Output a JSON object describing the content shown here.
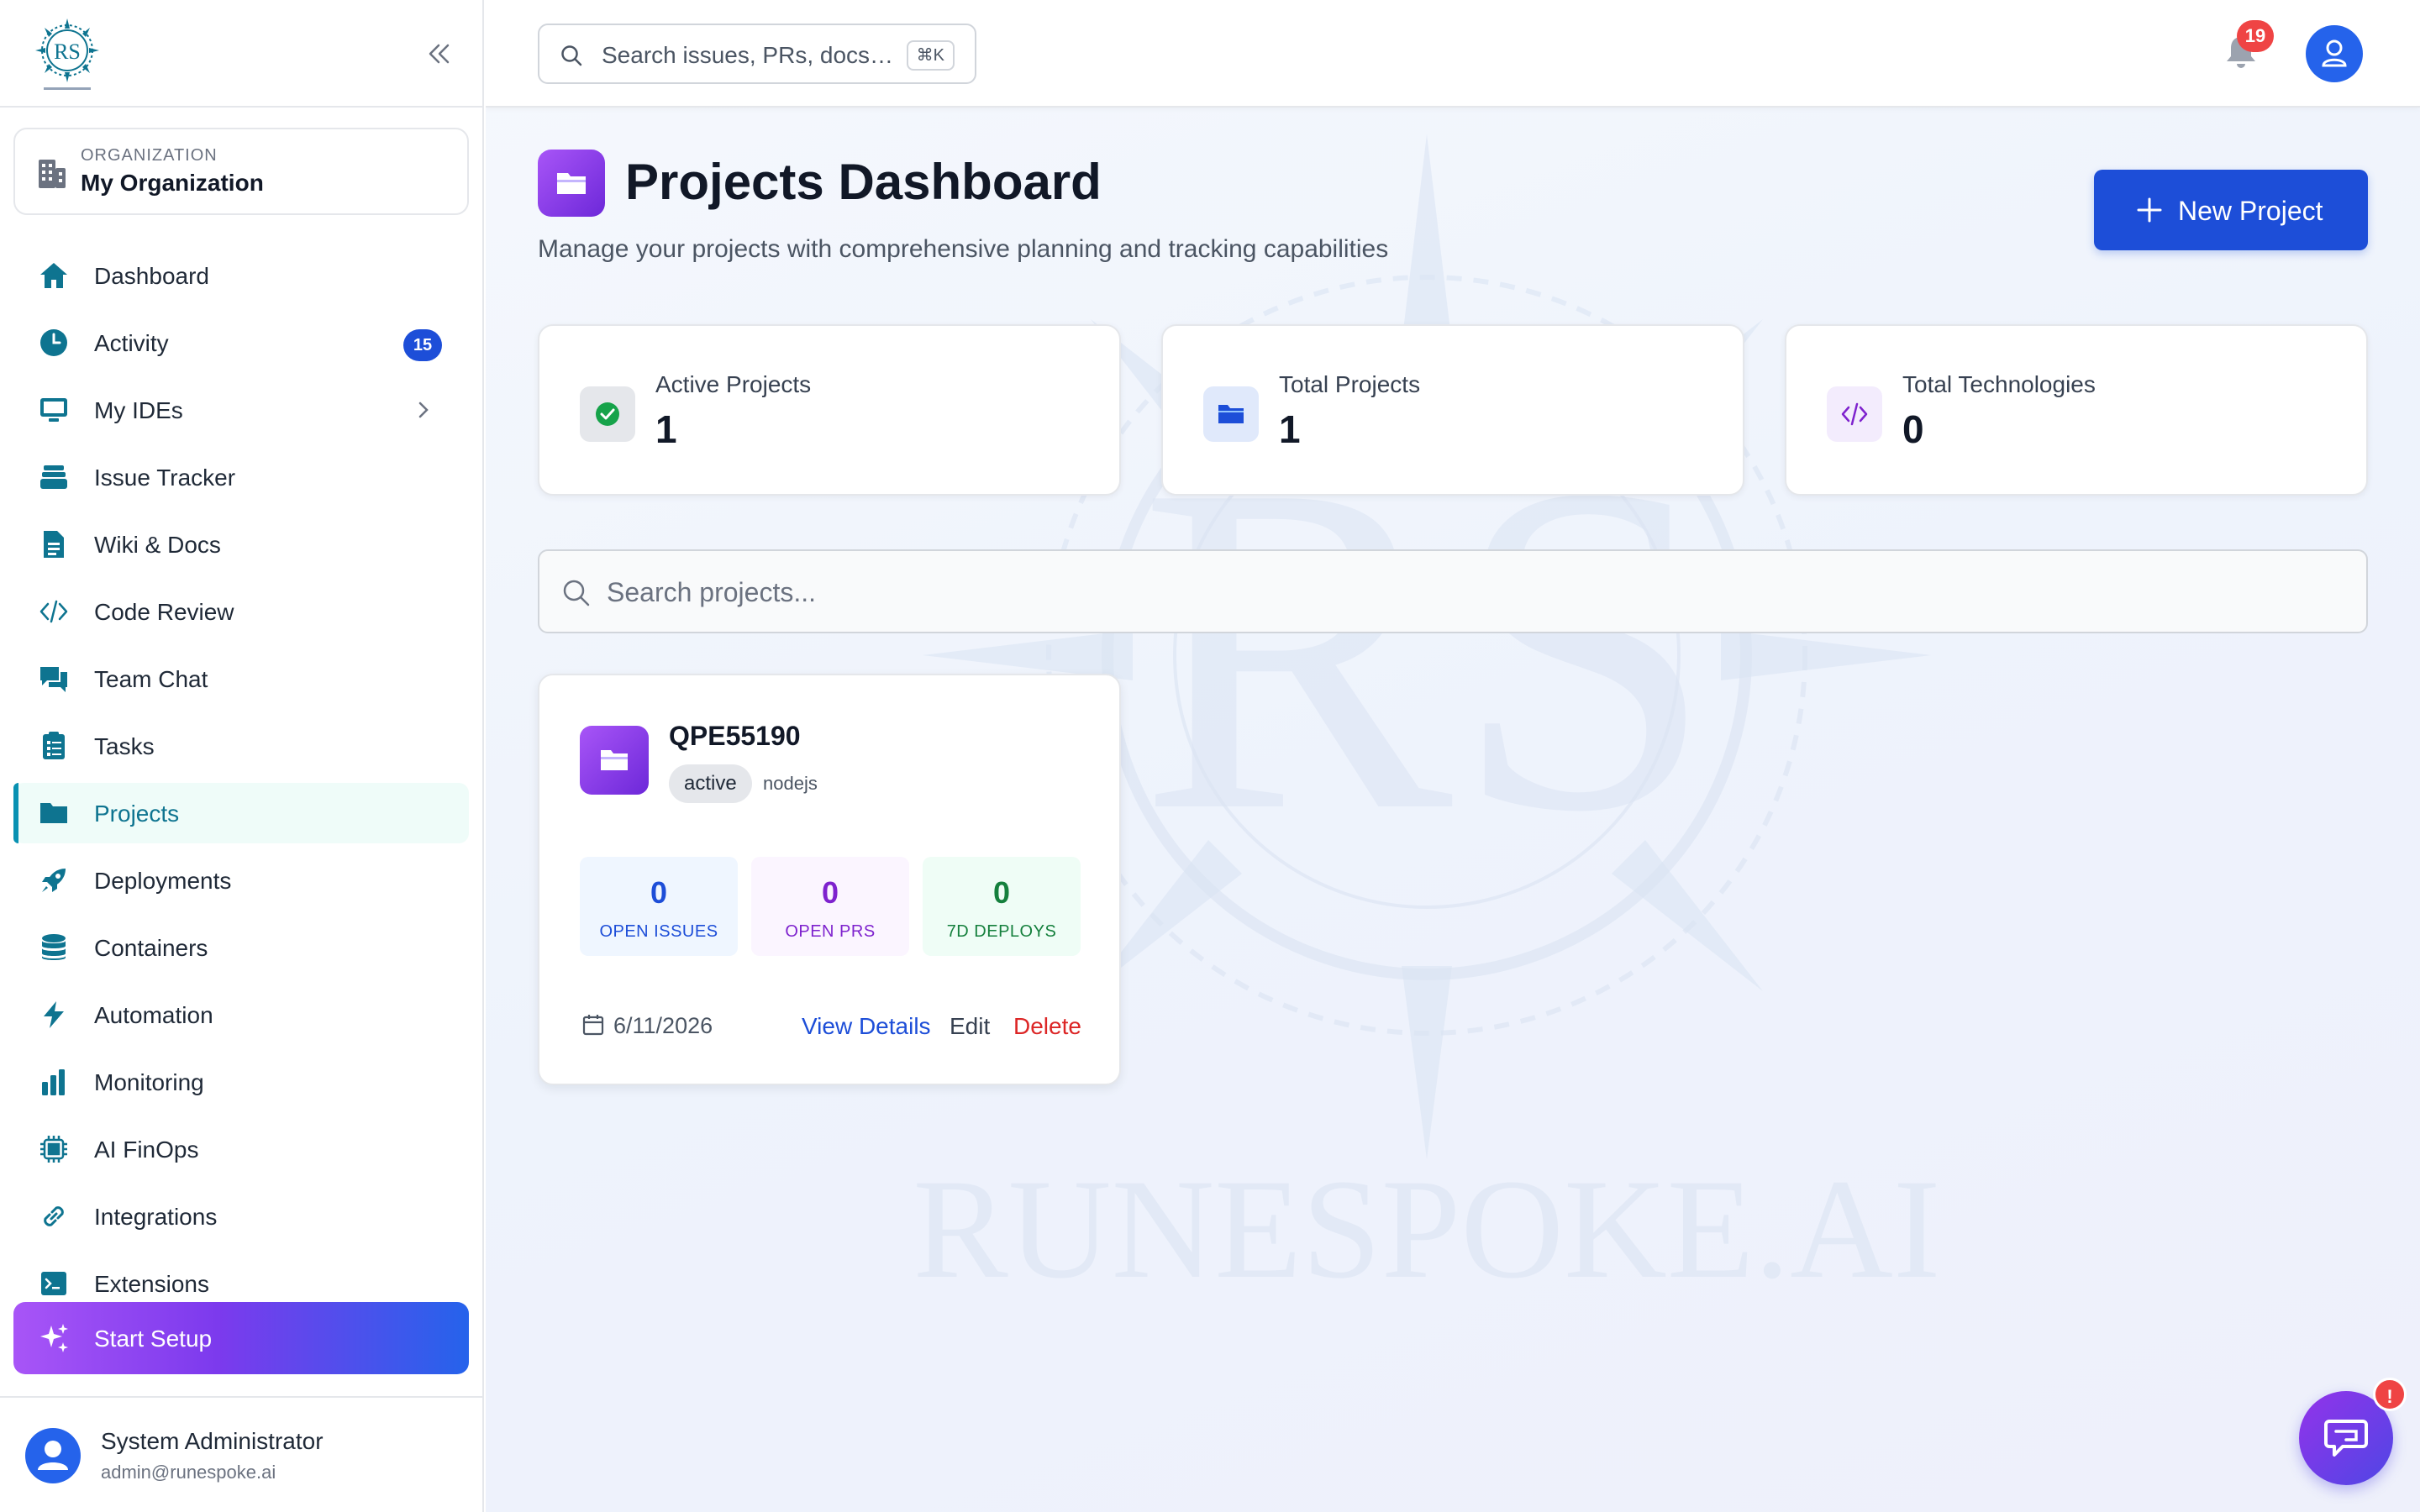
{
  "sidebar": {
    "organization": {
      "label": "ORGANIZATION",
      "name": "My Organization"
    },
    "items": [
      {
        "label": "Dashboard",
        "icon": "home-icon"
      },
      {
        "label": "Activity",
        "icon": "clock-icon",
        "badge": "15"
      },
      {
        "label": "My IDEs",
        "icon": "monitor-icon"
      },
      {
        "label": "Issue Tracker",
        "icon": "layers-icon"
      },
      {
        "label": "Wiki & Docs",
        "icon": "document-icon"
      },
      {
        "label": "Code Review",
        "icon": "code-icon"
      },
      {
        "label": "Team Chat",
        "icon": "chat-icon"
      },
      {
        "label": "Tasks",
        "icon": "clipboard-icon"
      },
      {
        "label": "Projects",
        "icon": "folder-icon",
        "active": true
      },
      {
        "label": "Deployments",
        "icon": "rocket-icon"
      },
      {
        "label": "Containers",
        "icon": "database-icon"
      },
      {
        "label": "Automation",
        "icon": "bolt-icon"
      },
      {
        "label": "Monitoring",
        "icon": "bar-chart-icon"
      },
      {
        "label": "AI FinOps",
        "icon": "chip-icon"
      },
      {
        "label": "Integrations",
        "icon": "link-icon"
      },
      {
        "label": "Extensions",
        "icon": "terminal-icon"
      }
    ],
    "setup_label": "Start Setup",
    "user": {
      "name": "System Administrator",
      "email": "admin@runespoke.ai"
    }
  },
  "topbar": {
    "search_placeholder": "Search issues, PRs, docs…",
    "shortcut": "⌘K",
    "notification_count": "19"
  },
  "watermark_text": "RUNESPOKE.AI",
  "page": {
    "title": "Projects Dashboard",
    "subtitle": "Manage your projects with comprehensive planning and tracking capabilities",
    "new_project_label": "New Project"
  },
  "stats": [
    {
      "label": "Active Projects",
      "value": "1"
    },
    {
      "label": "Total Projects",
      "value": "1"
    },
    {
      "label": "Total Technologies",
      "value": "0"
    }
  ],
  "project_search": {
    "placeholder": "Search projects..."
  },
  "projects": [
    {
      "name": "QPE55190",
      "status": "active",
      "technology": "nodejs",
      "metrics": [
        {
          "value": "0",
          "label": "OPEN ISSUES"
        },
        {
          "value": "0",
          "label": "OPEN PRS"
        },
        {
          "value": "0",
          "label": "7D DEPLOYS"
        }
      ],
      "date": "6/11/2026",
      "actions": {
        "view": "View Details",
        "edit": "Edit",
        "delete": "Delete"
      }
    }
  ],
  "chat": {
    "badge": "!"
  },
  "colors": {
    "primary": "#1d4ed8",
    "accent": "#0891b2",
    "purple": "#7c3aed",
    "danger": "#ef4444"
  }
}
